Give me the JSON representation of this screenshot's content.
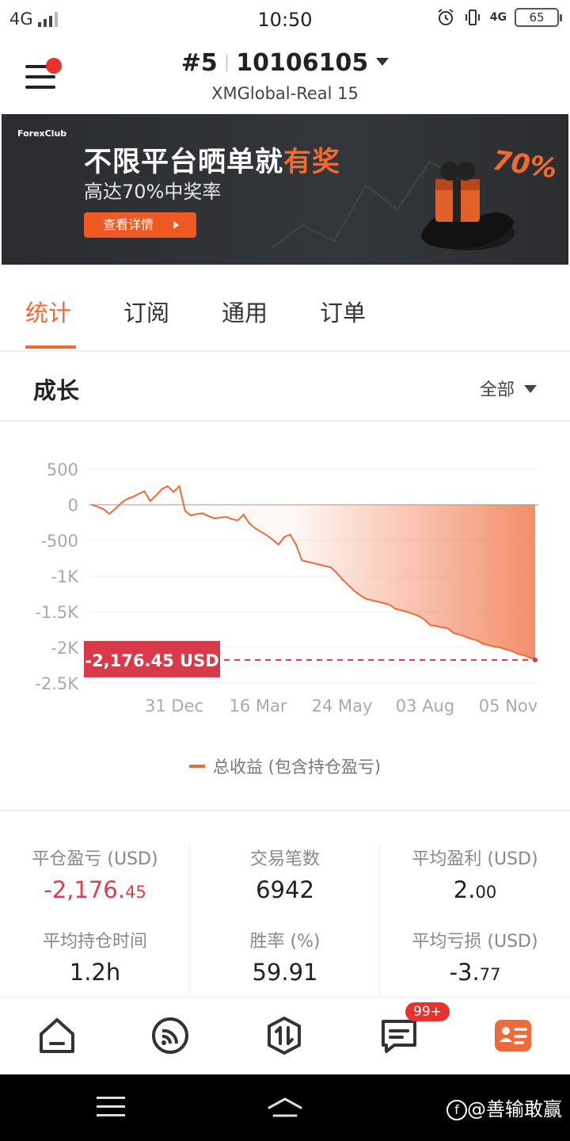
{
  "status_bar": {
    "network": "4G",
    "time": "10:50",
    "right_network": "4G",
    "battery": "65"
  },
  "header": {
    "rank": "#5",
    "account_number": "10106105",
    "server": "XMGlobal-Real 15"
  },
  "banner": {
    "logo_text_1": "Forex",
    "logo_text_2": "Club",
    "headline_part1": "不限平台晒单就",
    "headline_highlight": "有奖",
    "subtitle": "高达70%中奖率",
    "cta_label": "查看详情",
    "promo_percent": "70%"
  },
  "tabs": [
    {
      "label": "统计",
      "active": true
    },
    {
      "label": "订阅",
      "active": false
    },
    {
      "label": "通用",
      "active": false
    },
    {
      "label": "订单",
      "active": false
    }
  ],
  "growth": {
    "title": "成长",
    "filter_label": "全部"
  },
  "chart_data": {
    "type": "area",
    "title": "",
    "ylabel": "",
    "xlabel": "",
    "y_ticks": [
      "500",
      "0",
      "-500",
      "-1K",
      "-1.5K",
      "-2K",
      "-2.5K"
    ],
    "y_tick_values": [
      500,
      0,
      -500,
      -1000,
      -1500,
      -2000,
      -2500
    ],
    "x_ticks": [
      "31 Dec",
      "16 Mar",
      "24 May",
      "03 Aug",
      "05 Nov"
    ],
    "ylim": [
      -2500,
      500
    ],
    "current_value_label": "-2,176.45 USD",
    "current_value": -2176.45,
    "series": [
      {
        "name": "总收益 (包含持仓盈亏)",
        "color": "#ef6a3a",
        "values": [
          0,
          -30,
          -60,
          -130,
          -60,
          20,
          80,
          110,
          150,
          190,
          50,
          130,
          220,
          260,
          180,
          260,
          -90,
          -150,
          -130,
          -120,
          -160,
          -190,
          -180,
          -170,
          -200,
          -220,
          -140,
          -260,
          -330,
          -380,
          -430,
          -490,
          -560,
          -450,
          -420,
          -560,
          -780,
          -800,
          -820,
          -840,
          -860,
          -880,
          -960,
          -1050,
          -1130,
          -1210,
          -1270,
          -1320,
          -1340,
          -1360,
          -1380,
          -1400,
          -1460,
          -1480,
          -1500,
          -1530,
          -1560,
          -1610,
          -1690,
          -1700,
          -1720,
          -1730,
          -1800,
          -1820,
          -1850,
          -1880,
          -1900,
          -1950,
          -1970,
          -1990,
          -2000,
          -2030,
          -2050,
          -2090,
          -2110,
          -2140,
          -2176.45
        ]
      }
    ],
    "grid": true,
    "legend_position": "bottom-center"
  },
  "stats": {
    "closed_pnl": {
      "label": "平仓盈亏 (USD)",
      "value_main": "-2,176.",
      "value_dec": "45"
    },
    "trades": {
      "label": "交易笔数",
      "value": "6942"
    },
    "avg_profit": {
      "label": "平均盈利 (USD)",
      "value_main": "2.",
      "value_dec": "00"
    },
    "avg_hold": {
      "label": "平均持仓时间",
      "value": "1.2h"
    },
    "win_rate": {
      "label": "胜率 (%)",
      "value": "59.91"
    },
    "avg_loss": {
      "label": "平均亏损 (USD)",
      "value_main": "-3.",
      "value_dec": "77"
    }
  },
  "bottom_nav": {
    "items": [
      "home-icon",
      "feed-icon",
      "trade-icon",
      "message-icon",
      "profile-card-icon"
    ],
    "message_badge": "99+"
  },
  "watermark": "@善输敢赢"
}
